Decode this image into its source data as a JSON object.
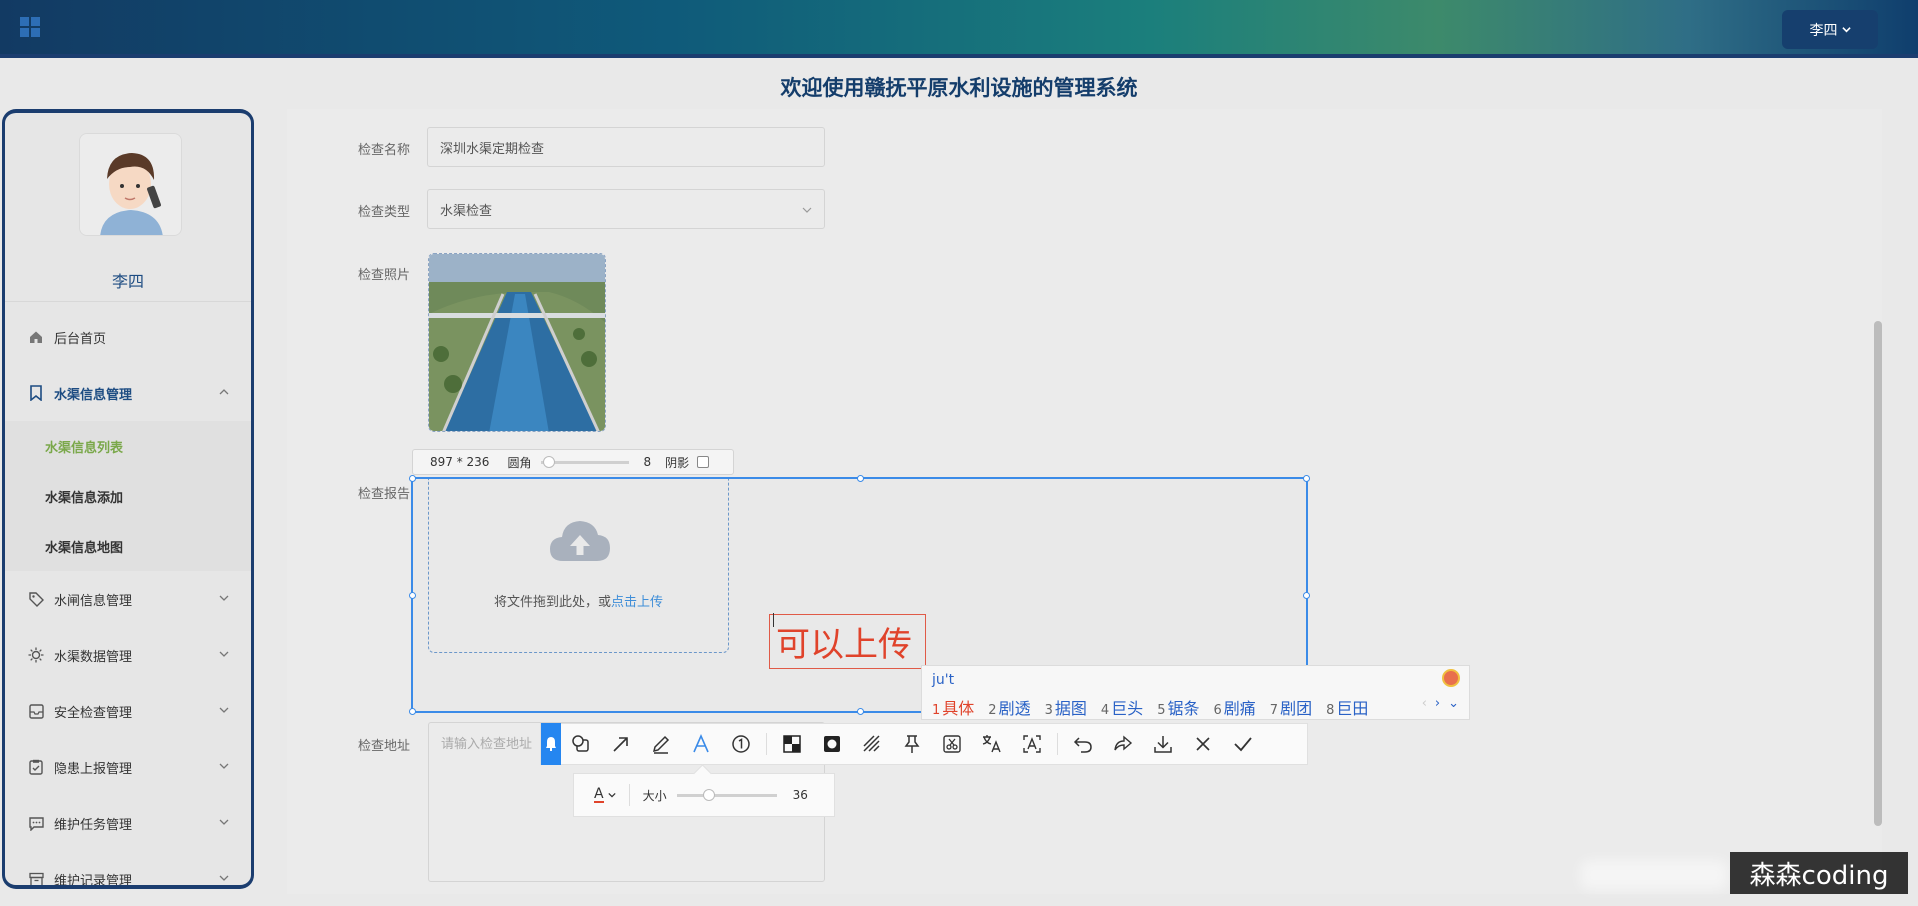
{
  "header": {
    "user_button": "李四"
  },
  "page_title": "欢迎使用赣抚平原水利设施的管理系统",
  "sidebar": {
    "user_name": "李四",
    "menu": [
      {
        "label": "后台首页",
        "icon": "home-icon"
      },
      {
        "label": "水渠信息管理",
        "icon": "bookmark-icon",
        "expanded": true,
        "children": [
          {
            "label": "水渠信息列表",
            "active": true
          },
          {
            "label": "水渠信息添加"
          },
          {
            "label": "水渠信息地图"
          }
        ]
      },
      {
        "label": "水闸信息管理",
        "icon": "tag-icon"
      },
      {
        "label": "水渠数据管理",
        "icon": "sun-icon"
      },
      {
        "label": "安全检查管理",
        "icon": "inbox-icon"
      },
      {
        "label": "隐患上报管理",
        "icon": "clipboard-icon"
      },
      {
        "label": "维护任务管理",
        "icon": "chat-icon"
      },
      {
        "label": "维护记录管理",
        "icon": "archive-icon"
      }
    ]
  },
  "form": {
    "name_label": "检查名称",
    "name_value": "深圳水渠定期检查",
    "type_label": "检查类型",
    "type_value": "水渠检查",
    "photo_label": "检查照片",
    "report_label": "检查报告",
    "upload_text": "将文件拖到此处，或",
    "upload_link": "点击上传",
    "address_label": "检查地址",
    "address_placeholder": "请输入检查地址"
  },
  "screenshot_tool": {
    "size": "897 * 236",
    "radius_label": "圆角",
    "radius_value": "8",
    "shadow_label": "阴影",
    "typed_text": "可以上传",
    "font_size_label": "大小",
    "font_size_value": "36",
    "accent_color": "#3b8be8",
    "text_color": "#e0432b"
  },
  "ime": {
    "input": "ju't",
    "candidates": [
      {
        "n": "1",
        "text": "具体"
      },
      {
        "n": "2",
        "text": "剧透"
      },
      {
        "n": "3",
        "text": "据图"
      },
      {
        "n": "4",
        "text": "巨头"
      },
      {
        "n": "5",
        "text": "锯条"
      },
      {
        "n": "6",
        "text": "剧痛"
      },
      {
        "n": "7",
        "text": "剧团"
      },
      {
        "n": "8",
        "text": "巨田"
      }
    ]
  },
  "watermark": "森森coding"
}
